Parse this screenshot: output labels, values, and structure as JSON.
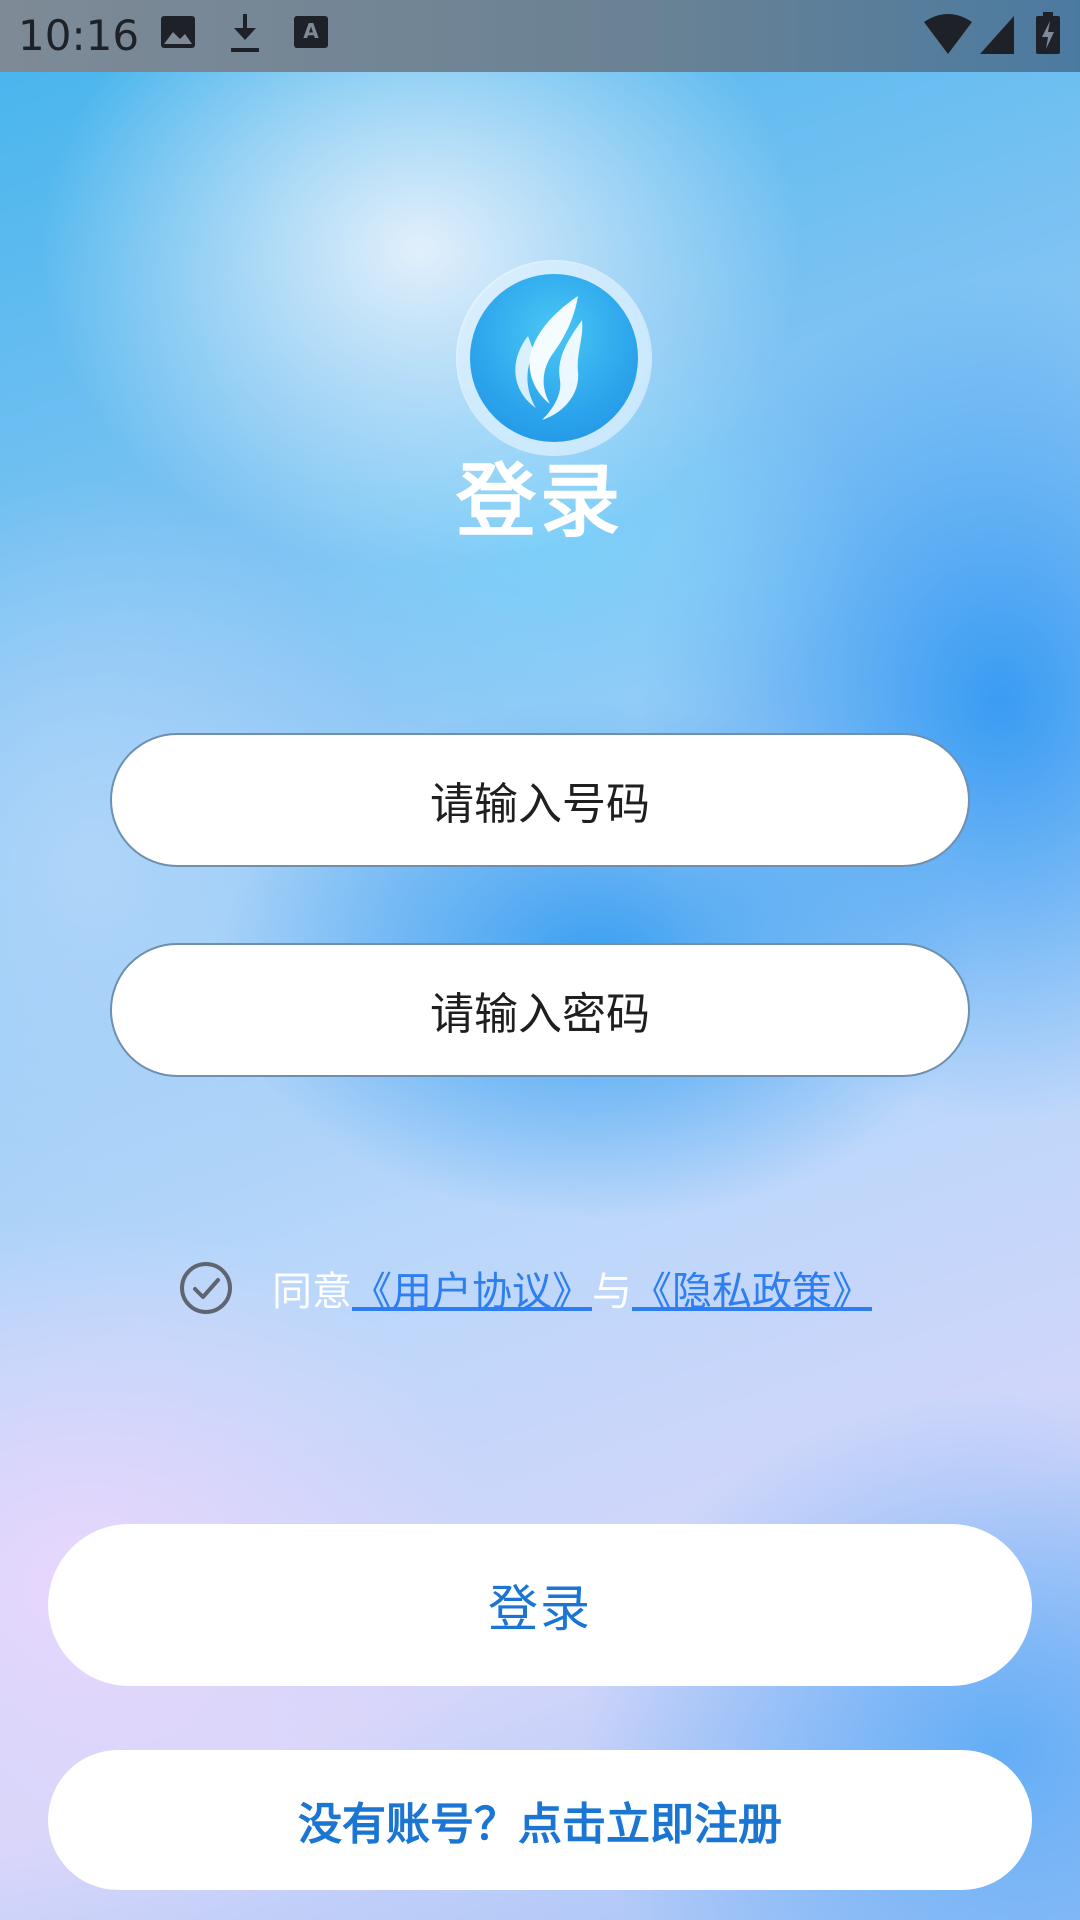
{
  "status_bar": {
    "time": "10:16",
    "icons": [
      "image-icon",
      "download-icon",
      "font-a-icon",
      "wifi-icon",
      "signal-icon",
      "battery-charging-icon"
    ]
  },
  "header": {
    "logo_icon": "flame-leaf-logo",
    "title": "登录"
  },
  "form": {
    "phone_placeholder": "请输入号码",
    "password_placeholder": "请输入密码"
  },
  "agreement": {
    "prefix": "同意",
    "user_agreement": "《用户协议》",
    "conjunction": "与",
    "privacy_policy": "《隐私政策》"
  },
  "actions": {
    "login_label": "登录",
    "register_label": "没有账号？点击立即注册"
  },
  "colors": {
    "accent": "#1a76d2",
    "link": "#2d7ef0",
    "title": "#ffffff"
  }
}
